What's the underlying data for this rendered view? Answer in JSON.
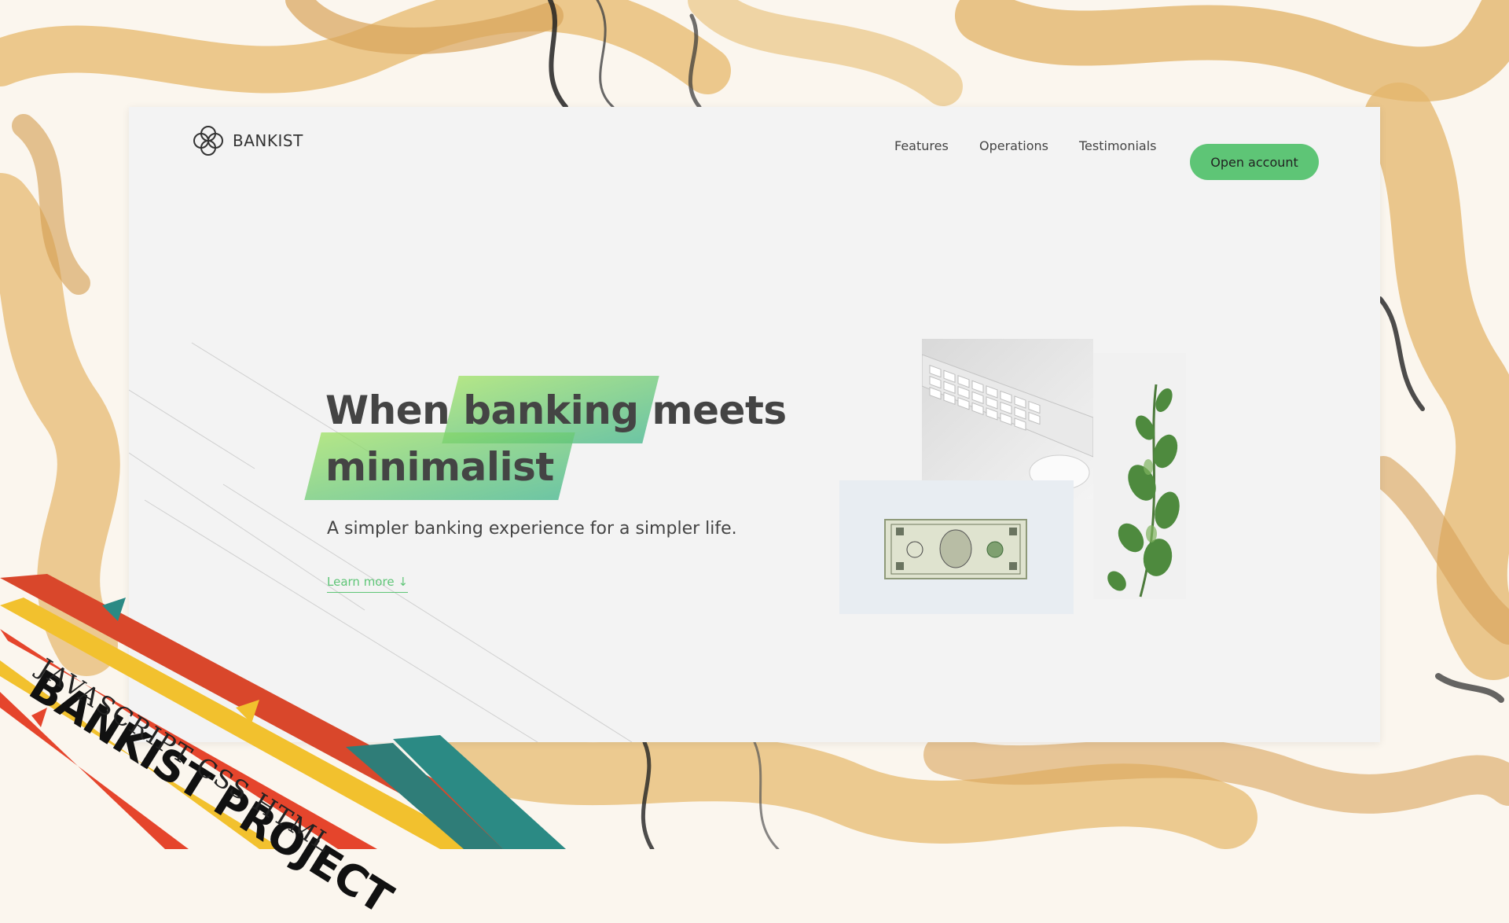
{
  "nav": {
    "logo_text": "BANKIST",
    "links": [
      "Features",
      "Operations",
      "Testimonials"
    ],
    "cta_label": "Open account"
  },
  "hero": {
    "title_word1": "When",
    "title_highlight1": "banking",
    "title_word2": "meets",
    "title_highlight2": "minimalist",
    "subtitle": "A simpler banking experience for a simpler life.",
    "learn_more": "Learn more",
    "learn_more_arrow": "↓"
  },
  "overlay": {
    "title": "BANKIST PROJECT",
    "subtitle": "JAVASCRIPT CSS HTML"
  },
  "colors": {
    "accent_green": "#5ec576",
    "gradient_start": "#39b385",
    "gradient_end": "#9be15d",
    "page_bg": "#f3f3f3",
    "marble_gold": "#e4b76a"
  }
}
